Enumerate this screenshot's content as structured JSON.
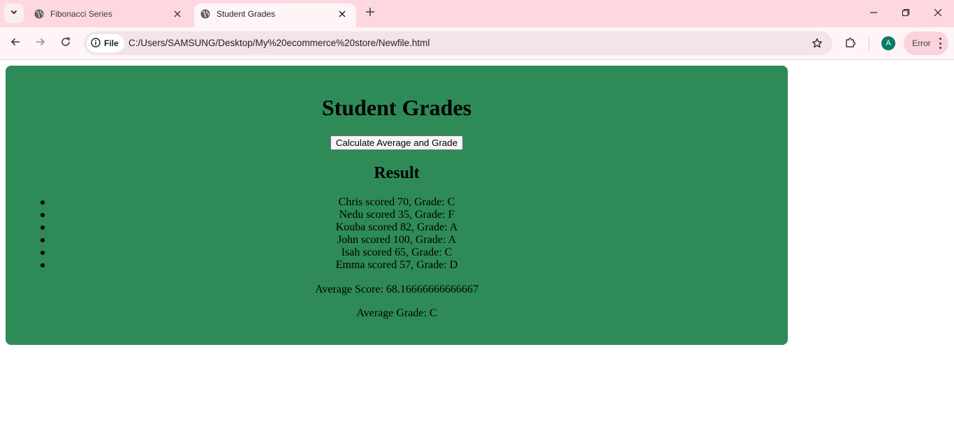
{
  "browser": {
    "tabs": [
      {
        "title": "Fibonacci Series",
        "active": false
      },
      {
        "title": "Student Grades",
        "active": true
      }
    ],
    "address": {
      "scheme_chip": "File",
      "url": "C:/Users/SAMSUNG/Desktop/My%20ecommerce%20store/Newfile.html"
    },
    "profile_initial": "A",
    "error_label": "Error"
  },
  "page": {
    "heading": "Student Grades",
    "button_label": "Calculate Average and Grade",
    "result_heading": "Result",
    "results": [
      "Chris scored 70, Grade: C",
      "Nedu scored 35, Grade: F",
      "Kouba scored 82, Grade: A",
      "John scored 100, Grade: A",
      "Isah scored 65, Grade: C",
      "Emma scored 57, Grade: D"
    ],
    "average_score": "Average Score: 68.16666666666667",
    "average_grade": "Average Grade: C",
    "container_color": "#2e8b57"
  }
}
